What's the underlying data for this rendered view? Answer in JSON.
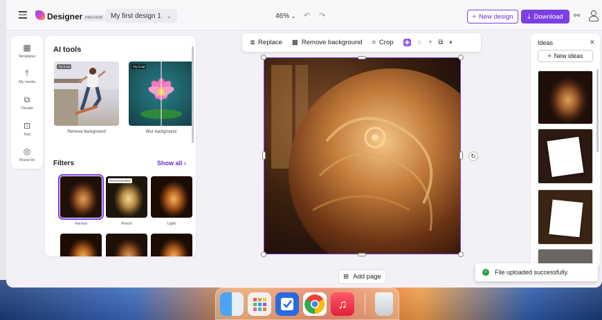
{
  "header": {
    "brand": "Designer",
    "preview_badge": "PREVIEW",
    "design_name": "My first design 1",
    "zoom": "46%",
    "new_design_label": "New design",
    "download_label": "Download"
  },
  "rail": {
    "items": [
      {
        "label": "Templates",
        "icon": "templates-icon"
      },
      {
        "label": "My media",
        "icon": "upload-icon"
      },
      {
        "label": "Visuals",
        "icon": "visuals-icon"
      },
      {
        "label": "Text",
        "icon": "text-icon"
      },
      {
        "label": "Brand kit",
        "icon": "brand-kit-icon"
      }
    ]
  },
  "panel": {
    "title": "AI tools",
    "tools": [
      {
        "label": "Remove background",
        "badge": "Try it out"
      },
      {
        "label": "Blur background",
        "badge": "Try it out"
      }
    ],
    "filters_title": "Filters",
    "show_all": "Show all",
    "filters": [
      {
        "label": "Normal",
        "selected": true
      },
      {
        "label": "Punch",
        "badge": "Recommended"
      },
      {
        "label": "Light"
      }
    ]
  },
  "toolbar": {
    "replace": "Replace",
    "remove_background": "Remove background",
    "crop": "Crop"
  },
  "canvas": {
    "add_page": "Add page"
  },
  "ideas": {
    "title": "Ideas",
    "new_ideas": "New ideas"
  },
  "toast": {
    "message": "File uploaded successfully."
  },
  "colors": {
    "accent": "#7b3fe4",
    "success": "#2e9a4a"
  }
}
